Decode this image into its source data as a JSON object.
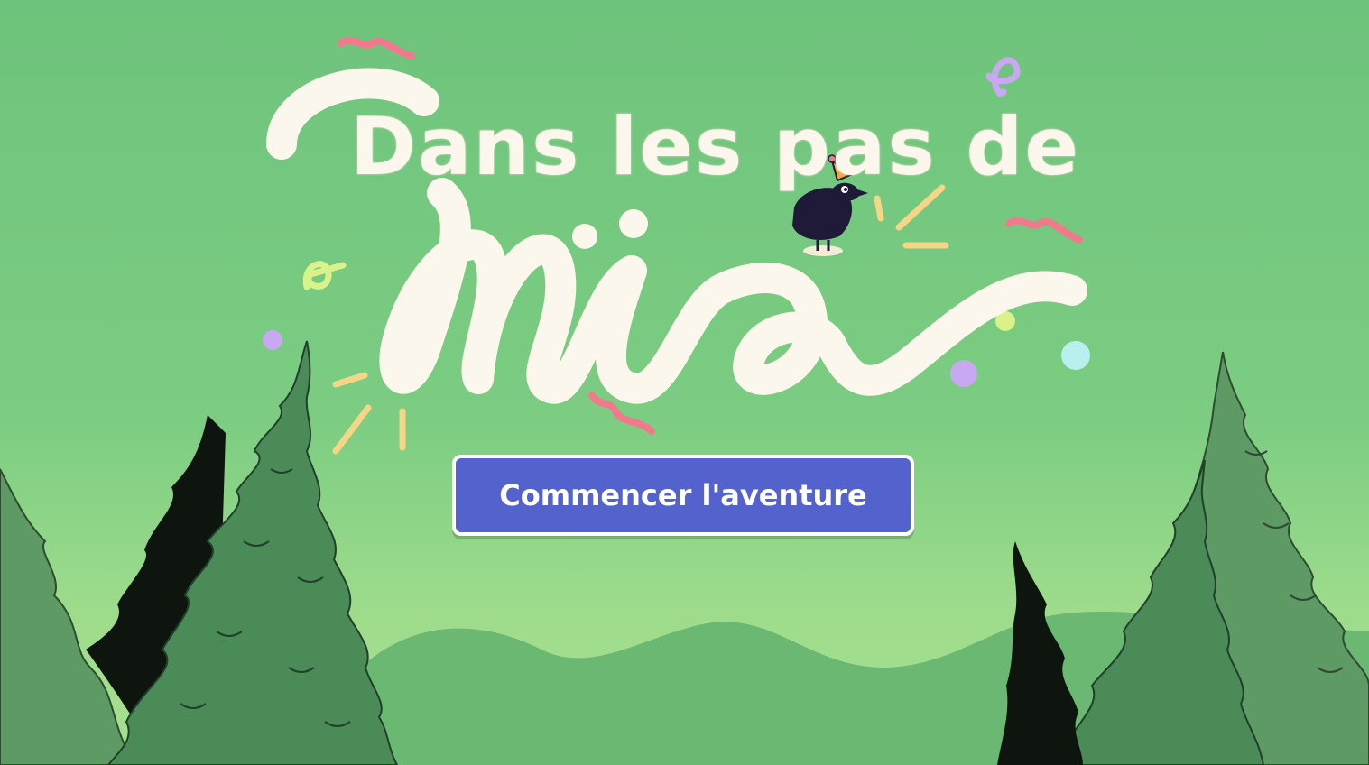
{
  "title": {
    "line1": "Dans les pas de",
    "line2": "mia"
  },
  "start_button": {
    "label": "Commencer l'aventure"
  },
  "colors": {
    "sky": "#6fc47d",
    "hills": "#6ab872",
    "lettering": "#fbf7ec",
    "button": "#5362cc",
    "tree_light": "#5d9a64",
    "tree_mid": "#4a8b58",
    "tree_dark": "#0d150e",
    "confetti_pink": "#f07a8c",
    "confetti_lilac": "#c8a8f0",
    "confetti_yellow": "#f4d686",
    "confetti_lime": "#d9f28a",
    "confetti_cyan": "#b8f0f0"
  },
  "icons": {
    "mascot": "crow-with-party-hat-icon"
  }
}
